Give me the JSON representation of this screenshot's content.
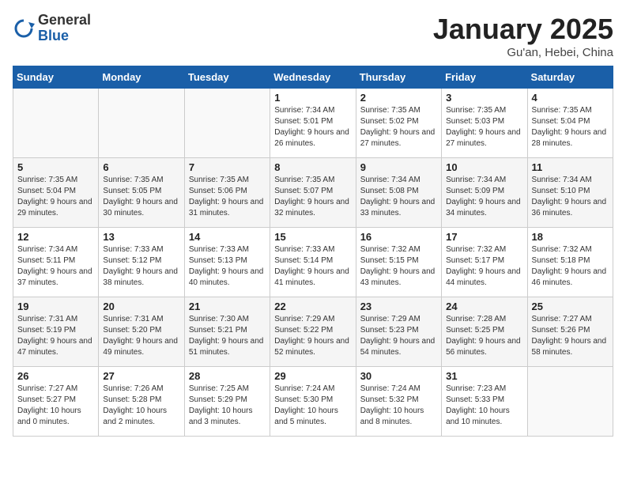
{
  "logo": {
    "general": "General",
    "blue": "Blue"
  },
  "header": {
    "title": "January 2025",
    "subtitle": "Gu'an, Hebei, China"
  },
  "weekdays": [
    "Sunday",
    "Monday",
    "Tuesday",
    "Wednesday",
    "Thursday",
    "Friday",
    "Saturday"
  ],
  "weeks": [
    [
      {
        "day": "",
        "info": ""
      },
      {
        "day": "",
        "info": ""
      },
      {
        "day": "",
        "info": ""
      },
      {
        "day": "1",
        "info": "Sunrise: 7:34 AM\nSunset: 5:01 PM\nDaylight: 9 hours\nand 26 minutes."
      },
      {
        "day": "2",
        "info": "Sunrise: 7:35 AM\nSunset: 5:02 PM\nDaylight: 9 hours\nand 27 minutes."
      },
      {
        "day": "3",
        "info": "Sunrise: 7:35 AM\nSunset: 5:03 PM\nDaylight: 9 hours\nand 27 minutes."
      },
      {
        "day": "4",
        "info": "Sunrise: 7:35 AM\nSunset: 5:04 PM\nDaylight: 9 hours\nand 28 minutes."
      }
    ],
    [
      {
        "day": "5",
        "info": "Sunrise: 7:35 AM\nSunset: 5:04 PM\nDaylight: 9 hours\nand 29 minutes."
      },
      {
        "day": "6",
        "info": "Sunrise: 7:35 AM\nSunset: 5:05 PM\nDaylight: 9 hours\nand 30 minutes."
      },
      {
        "day": "7",
        "info": "Sunrise: 7:35 AM\nSunset: 5:06 PM\nDaylight: 9 hours\nand 31 minutes."
      },
      {
        "day": "8",
        "info": "Sunrise: 7:35 AM\nSunset: 5:07 PM\nDaylight: 9 hours\nand 32 minutes."
      },
      {
        "day": "9",
        "info": "Sunrise: 7:34 AM\nSunset: 5:08 PM\nDaylight: 9 hours\nand 33 minutes."
      },
      {
        "day": "10",
        "info": "Sunrise: 7:34 AM\nSunset: 5:09 PM\nDaylight: 9 hours\nand 34 minutes."
      },
      {
        "day": "11",
        "info": "Sunrise: 7:34 AM\nSunset: 5:10 PM\nDaylight: 9 hours\nand 36 minutes."
      }
    ],
    [
      {
        "day": "12",
        "info": "Sunrise: 7:34 AM\nSunset: 5:11 PM\nDaylight: 9 hours\nand 37 minutes."
      },
      {
        "day": "13",
        "info": "Sunrise: 7:33 AM\nSunset: 5:12 PM\nDaylight: 9 hours\nand 38 minutes."
      },
      {
        "day": "14",
        "info": "Sunrise: 7:33 AM\nSunset: 5:13 PM\nDaylight: 9 hours\nand 40 minutes."
      },
      {
        "day": "15",
        "info": "Sunrise: 7:33 AM\nSunset: 5:14 PM\nDaylight: 9 hours\nand 41 minutes."
      },
      {
        "day": "16",
        "info": "Sunrise: 7:32 AM\nSunset: 5:15 PM\nDaylight: 9 hours\nand 43 minutes."
      },
      {
        "day": "17",
        "info": "Sunrise: 7:32 AM\nSunset: 5:17 PM\nDaylight: 9 hours\nand 44 minutes."
      },
      {
        "day": "18",
        "info": "Sunrise: 7:32 AM\nSunset: 5:18 PM\nDaylight: 9 hours\nand 46 minutes."
      }
    ],
    [
      {
        "day": "19",
        "info": "Sunrise: 7:31 AM\nSunset: 5:19 PM\nDaylight: 9 hours\nand 47 minutes."
      },
      {
        "day": "20",
        "info": "Sunrise: 7:31 AM\nSunset: 5:20 PM\nDaylight: 9 hours\nand 49 minutes."
      },
      {
        "day": "21",
        "info": "Sunrise: 7:30 AM\nSunset: 5:21 PM\nDaylight: 9 hours\nand 51 minutes."
      },
      {
        "day": "22",
        "info": "Sunrise: 7:29 AM\nSunset: 5:22 PM\nDaylight: 9 hours\nand 52 minutes."
      },
      {
        "day": "23",
        "info": "Sunrise: 7:29 AM\nSunset: 5:23 PM\nDaylight: 9 hours\nand 54 minutes."
      },
      {
        "day": "24",
        "info": "Sunrise: 7:28 AM\nSunset: 5:25 PM\nDaylight: 9 hours\nand 56 minutes."
      },
      {
        "day": "25",
        "info": "Sunrise: 7:27 AM\nSunset: 5:26 PM\nDaylight: 9 hours\nand 58 minutes."
      }
    ],
    [
      {
        "day": "26",
        "info": "Sunrise: 7:27 AM\nSunset: 5:27 PM\nDaylight: 10 hours\nand 0 minutes."
      },
      {
        "day": "27",
        "info": "Sunrise: 7:26 AM\nSunset: 5:28 PM\nDaylight: 10 hours\nand 2 minutes."
      },
      {
        "day": "28",
        "info": "Sunrise: 7:25 AM\nSunset: 5:29 PM\nDaylight: 10 hours\nand 3 minutes."
      },
      {
        "day": "29",
        "info": "Sunrise: 7:24 AM\nSunset: 5:30 PM\nDaylight: 10 hours\nand 5 minutes."
      },
      {
        "day": "30",
        "info": "Sunrise: 7:24 AM\nSunset: 5:32 PM\nDaylight: 10 hours\nand 8 minutes."
      },
      {
        "day": "31",
        "info": "Sunrise: 7:23 AM\nSunset: 5:33 PM\nDaylight: 10 hours\nand 10 minutes."
      },
      {
        "day": "",
        "info": ""
      }
    ]
  ]
}
